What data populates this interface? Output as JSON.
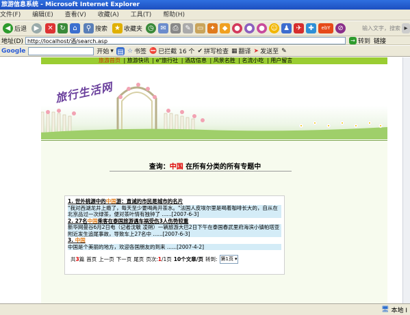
{
  "window": {
    "title": "旅游信息系统 - Microsoft Internet Explorer"
  },
  "menu": [
    "文件(F)",
    "编辑(E)",
    "查看(V)",
    "收藏(A)",
    "工具(T)",
    "帮助(H)"
  ],
  "toolbar": {
    "back_label": "后退",
    "search_label": "搜索",
    "favorites_label": "收藏夹"
  },
  "address": {
    "label": "地址(D)",
    "url": "http://localhost/酒/search.asp",
    "goto_label": "转到",
    "links_label": "链接"
  },
  "googlebar": {
    "logo": "Google",
    "start_label": "开始",
    "bookmarks_label": "书签",
    "blocked_label": "已拦截 16 个",
    "spellcheck_label": "拼写检查",
    "translate_label": "翻译",
    "sendto_label": "发送至"
  },
  "ie_search_placeholder": "输入文字，搜索",
  "nav": {
    "items": [
      "旅游首页",
      "旅游快讯",
      "e\"旅行社",
      "酒店信息",
      "风景名胜",
      "名流小吃",
      "用户留言"
    ]
  },
  "banner": {
    "title": "旅行生活网"
  },
  "search_heading": {
    "prefix": "查询：",
    "keyword": "中国",
    "suffix": "在所有分类的所有专题中"
  },
  "results": [
    {
      "num": "1.",
      "title_before": "世外桃源中的",
      "title_hl": "中国",
      "title_after": "游：直诫的市民是城市的名片",
      "body": "\"我对西湖龙井上瘾了，每天至少要喝两开茶水。\"法国人皮埃尔里是喝着咖啡长大的，自从在北京品过一次绿茶，便对茶叶情有独钟了 ......[2007-6-3]"
    },
    {
      "num": "2.",
      "title_before": "27名",
      "title_hl": "中国",
      "title_after": "乘客在泰国旅游遇车祸受伤3人伤势较重",
      "body": "新华网曼谷6月2日电（记者沈敏 凌朔）一辆旅游大巴2日下午在泰国春武里府海滨小镇帕塔亚附近发生追尾事故，导致车上27名中 ......[2007-6-3]"
    },
    {
      "num": "3.",
      "title_before": "",
      "title_hl": "中国",
      "title_after": "",
      "body": "中国是个美丽的地方，欢迎各国朋友的到来 ......[2007-4-2]"
    }
  ],
  "pager": {
    "total_prefix": "共",
    "total_count": "3",
    "total_suffix": "篇",
    "first": "首页",
    "prev": "上一页",
    "next": "下一页",
    "last": "尾页",
    "page_label": "页次:",
    "page_current": "1",
    "page_total": "/1页",
    "per_page": "10个文章/页",
    "goto_label": "转到:",
    "select_value": "第1页"
  },
  "status": {
    "zone": "本地 I"
  }
}
